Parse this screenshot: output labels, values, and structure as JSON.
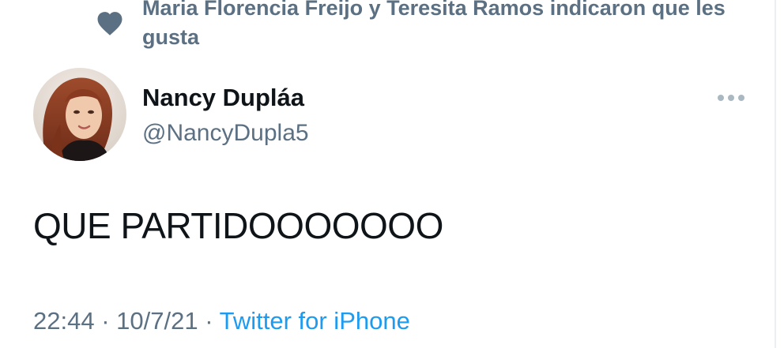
{
  "social_context": {
    "text": "Maria Florencia Freijo y Teresita Ramos indicaron que les gusta",
    "icon": "heart-icon"
  },
  "author": {
    "name": "Nancy Dupláa",
    "handle": "@NancyDupla5",
    "avatar_alt": "profile photo"
  },
  "menu": {
    "icon": "more-icon"
  },
  "tweet": {
    "text": "QUE PARTIDOOOOOOO",
    "time": "22:44",
    "date": "10/7/21",
    "separator": "·",
    "source": "Twitter for iPhone"
  },
  "colors": {
    "secondary_text": "#5b7083",
    "link": "#1d9bf0",
    "primary_text": "#0f1419",
    "heart": "#5b7083"
  }
}
